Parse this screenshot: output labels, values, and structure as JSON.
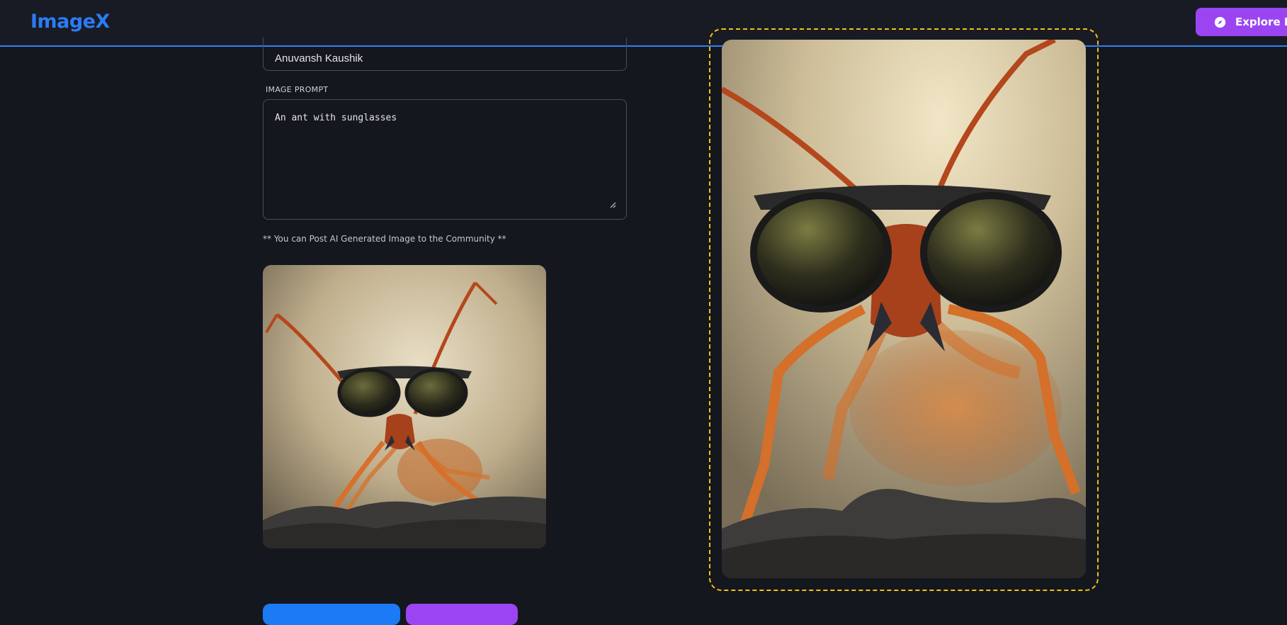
{
  "navbar": {
    "logo": "ImageX",
    "explore_button": {
      "label": "Explore Posts",
      "icon": "compass-icon"
    }
  },
  "form": {
    "name_value": "Anuvansh Kaushik",
    "prompt_label": "IMAGE PROMPT",
    "prompt_value": "An ant with sunglasses",
    "hint": "** You can Post AI Generated Image to the Community **"
  },
  "images": {
    "thumbnail": "ant-with-sunglasses-thumbnail",
    "preview": "ant-with-sunglasses-preview"
  },
  "colors": {
    "background": "#15171e",
    "navbar": "#181b24",
    "accent_blue": "#2b7cf6",
    "accent_purple": "#9b45f2",
    "preview_border": "#f2c112"
  }
}
